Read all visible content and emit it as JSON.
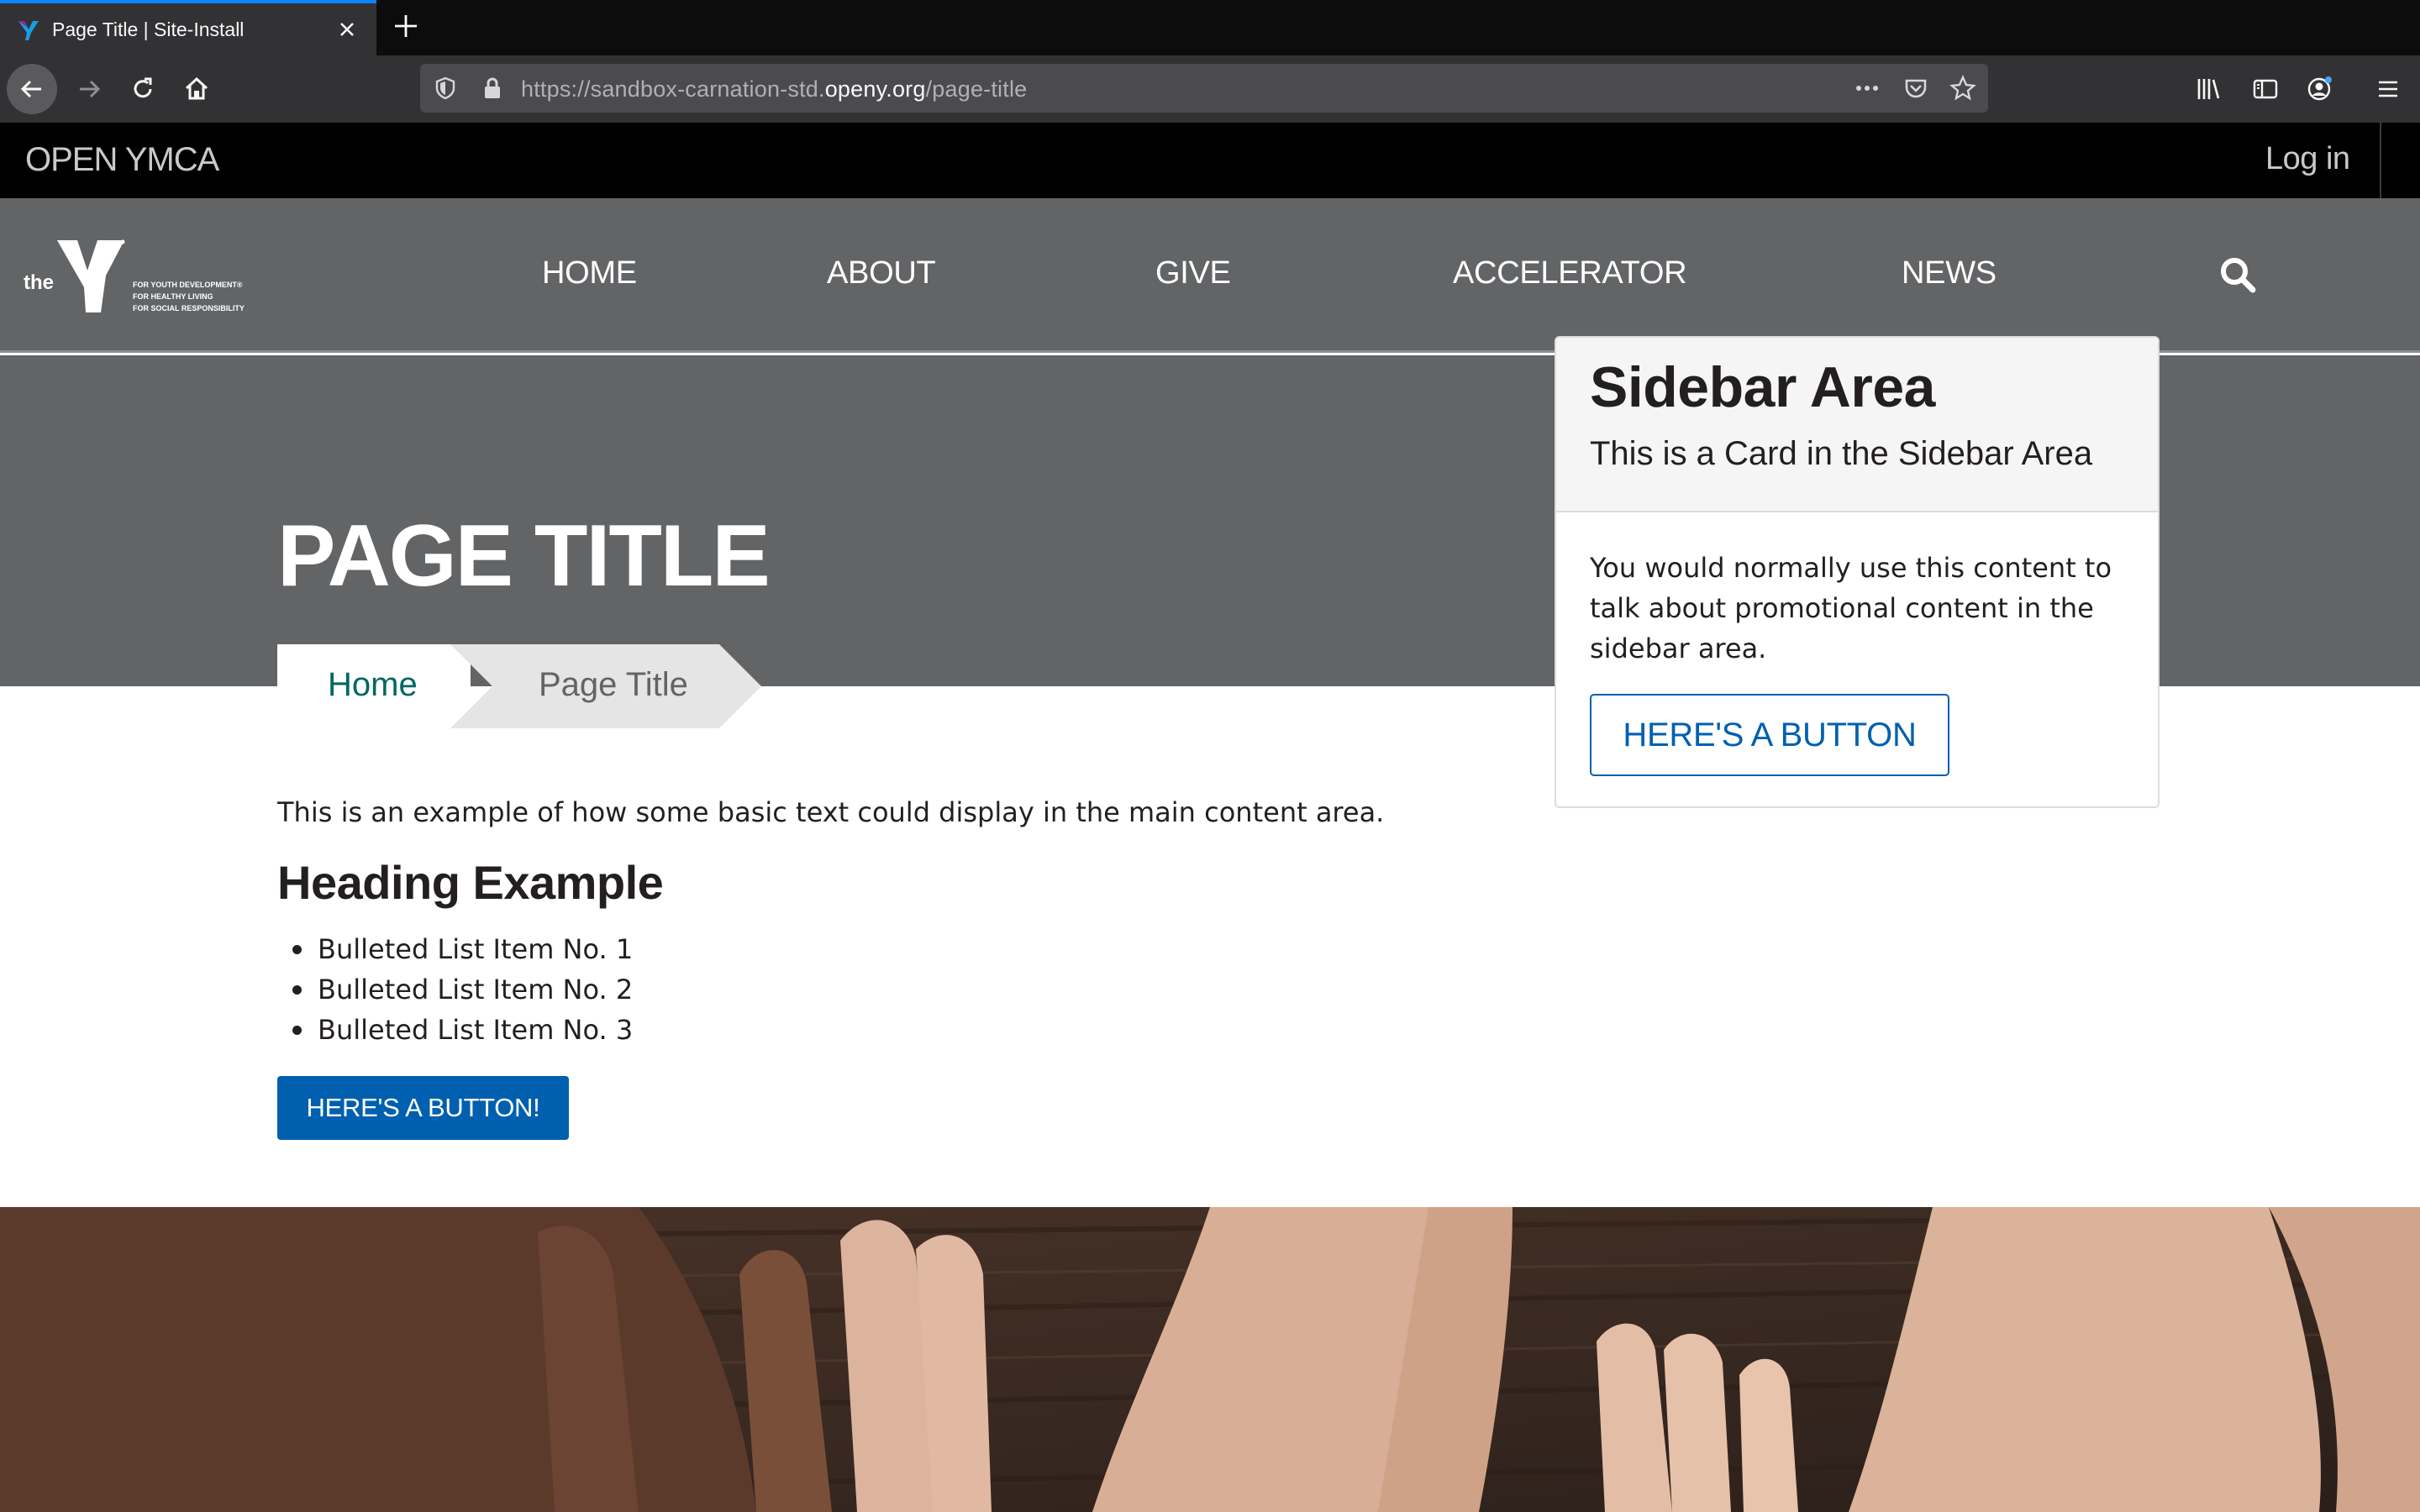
{
  "browser": {
    "tab_title": "Page Title | Site-Install",
    "url_prefix": "https://sandbox-carnation-std.",
    "url_host": "openy.org",
    "url_path": "/page-title"
  },
  "site": {
    "brand": "OPEN YMCA",
    "login_label": "Log in",
    "logo_text": {
      "the": "the",
      "line1": "FOR YOUTH DEVELOPMENT®",
      "line2": "FOR HEALTHY LIVING",
      "line3": "FOR SOCIAL RESPONSIBILITY"
    }
  },
  "nav": {
    "items": [
      {
        "label": "HOME"
      },
      {
        "label": "ABOUT"
      },
      {
        "label": "GIVE"
      },
      {
        "label": "ACCELERATOR"
      },
      {
        "label": "NEWS"
      }
    ]
  },
  "hero": {
    "title": "PAGE TITLE"
  },
  "breadcrumb": {
    "home": "Home",
    "current": "Page Title"
  },
  "content": {
    "intro": "This is an example of how some basic text could display in the main content area.",
    "heading": "Heading Example",
    "bullets": [
      "Bulleted List Item No. 1",
      "Bulleted List Item No. 2",
      "Bulleted List Item No. 3"
    ],
    "button_label": "HERE'S A BUTTON!"
  },
  "sidebar": {
    "title": "Sidebar Area",
    "subtitle": "This is a Card in the Sidebar Area",
    "body": "You would normally use this content to talk about promotional content in the sidebar area.",
    "button_label": "HERE'S A BUTTON"
  },
  "colors": {
    "brand_blue": "#0060af",
    "nav_gray": "#636466",
    "breadcrumb_teal": "#006761",
    "topbar_black": "#000000"
  }
}
